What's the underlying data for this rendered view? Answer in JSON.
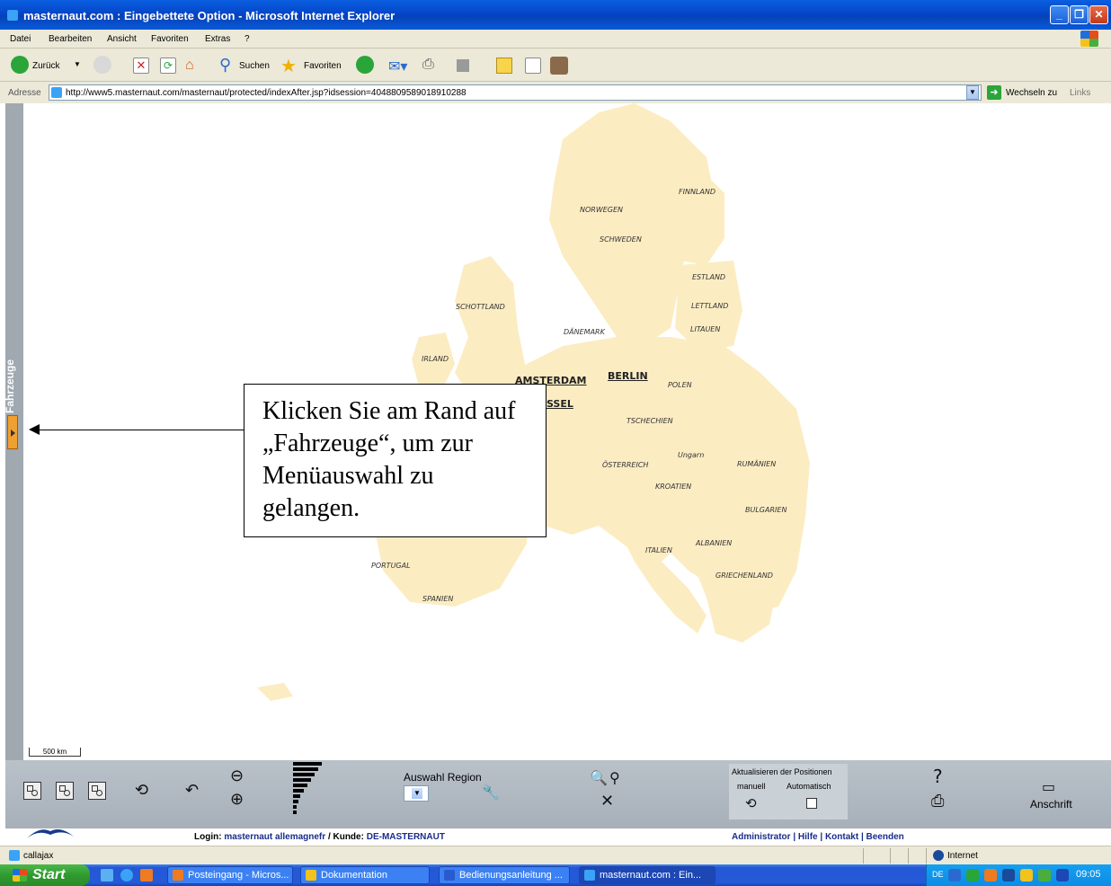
{
  "window": {
    "title": "masternaut.com : Eingebettete Option - Microsoft Internet Explorer"
  },
  "menu": [
    "Datei",
    "Bearbeiten",
    "Ansicht",
    "Favoriten",
    "Extras",
    "?"
  ],
  "toolbar": {
    "back_label": "Zurück",
    "search_label": "Suchen",
    "favorites_label": "Favoriten"
  },
  "address": {
    "label": "Adresse",
    "url": "http://www5.masternaut.com/masternaut/protected/indexAfter.jsp?idsession=4048809589018910288",
    "go_label": "Wechseln zu",
    "links_label": "Links"
  },
  "sidebar": {
    "label": "Fahrzeuge"
  },
  "map": {
    "land_color": "#fcecc2",
    "countries": [
      "FINNLAND",
      "NORWEGEN",
      "SCHWEDEN",
      "ESTLAND",
      "SCHOTTLAND",
      "LETTLAND",
      "DÄNEMARK",
      "LITAUEN",
      "IRLAND",
      "POLEN",
      "TSCHECHIEN",
      "Ungarn",
      "ÖSTERREICH",
      "RUMÄNIEN",
      "KROATIEN",
      "BULGARIEN",
      "ALBANIEN",
      "ITALIEN",
      "PORTUGAL",
      "GRIECHENLAND",
      "SPANIEN"
    ],
    "cities": [
      "AMSTERDAM",
      "BERLIN",
      "SSEL"
    ],
    "scale_label": "500 km"
  },
  "callout": {
    "text": "Klicken Sie am Rand auf „Fahrzeuge“, um zur Menüauswahl zu gelangen."
  },
  "map_toolbar": {
    "region_label": "Auswahl Region",
    "update_title": "Aktualisieren der Positionen",
    "manual_label": "manuell",
    "auto_label": "Automatisch",
    "address_label": "Anschrift"
  },
  "login": {
    "login_prefix": "Login:",
    "login_user": "masternaut allemagnefr",
    "customer_prefix": "/ Kunde:",
    "customer": "DE-MASTERNAUT",
    "links": "Administrator | Hilfe | Kontakt | Beenden"
  },
  "status": {
    "left": "callajax",
    "zone": "Internet"
  },
  "taskbar": {
    "start_label": "Start",
    "tasks": [
      "Posteingang - Micros...",
      "Dokumentation",
      "Bedienungsanleitung ...",
      "masternaut.com : Ein..."
    ],
    "lang": "DE",
    "clock": "09:05"
  }
}
